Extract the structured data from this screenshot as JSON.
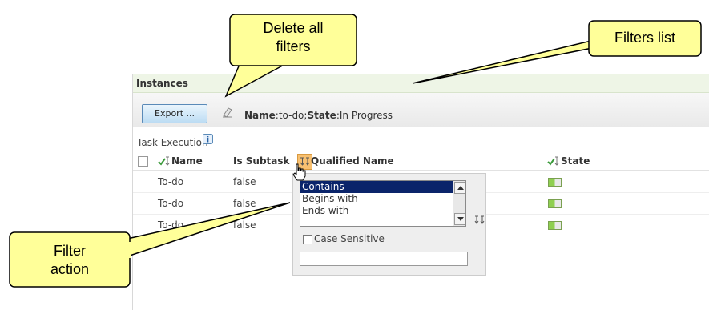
{
  "panel": {
    "title": "Instances"
  },
  "toolbar": {
    "export_label": "Export ...",
    "filter_name_key": "Name",
    "filter_name_value": ":to-do;",
    "filter_state_key": "State",
    "filter_state_value": ":In Progress"
  },
  "section": {
    "label": "Task Execution"
  },
  "columns": [
    "Name",
    "Is Subtask",
    "Qualified Name",
    "State"
  ],
  "rows": [
    {
      "name": "To-do",
      "is_subtask": "false"
    },
    {
      "name": "To-do",
      "is_subtask": "false"
    },
    {
      "name": "To-do",
      "is_subtask": "false"
    }
  ],
  "filter_popup": {
    "options": [
      "Contains",
      "Begins with",
      "Ends with"
    ],
    "selected": "Contains",
    "case_sensitive_label": "Case Sensitive",
    "case_sensitive": false,
    "input_value": ""
  },
  "callouts": {
    "delete_line1": "Delete all",
    "delete_line2": "filters",
    "filters_list": "Filters list",
    "filter_line1": "Filter",
    "filter_line2": "action"
  },
  "colors": {
    "callout_fill": "#ffff99",
    "accent": "#0a246a",
    "title_bg": "#eef5e6"
  }
}
